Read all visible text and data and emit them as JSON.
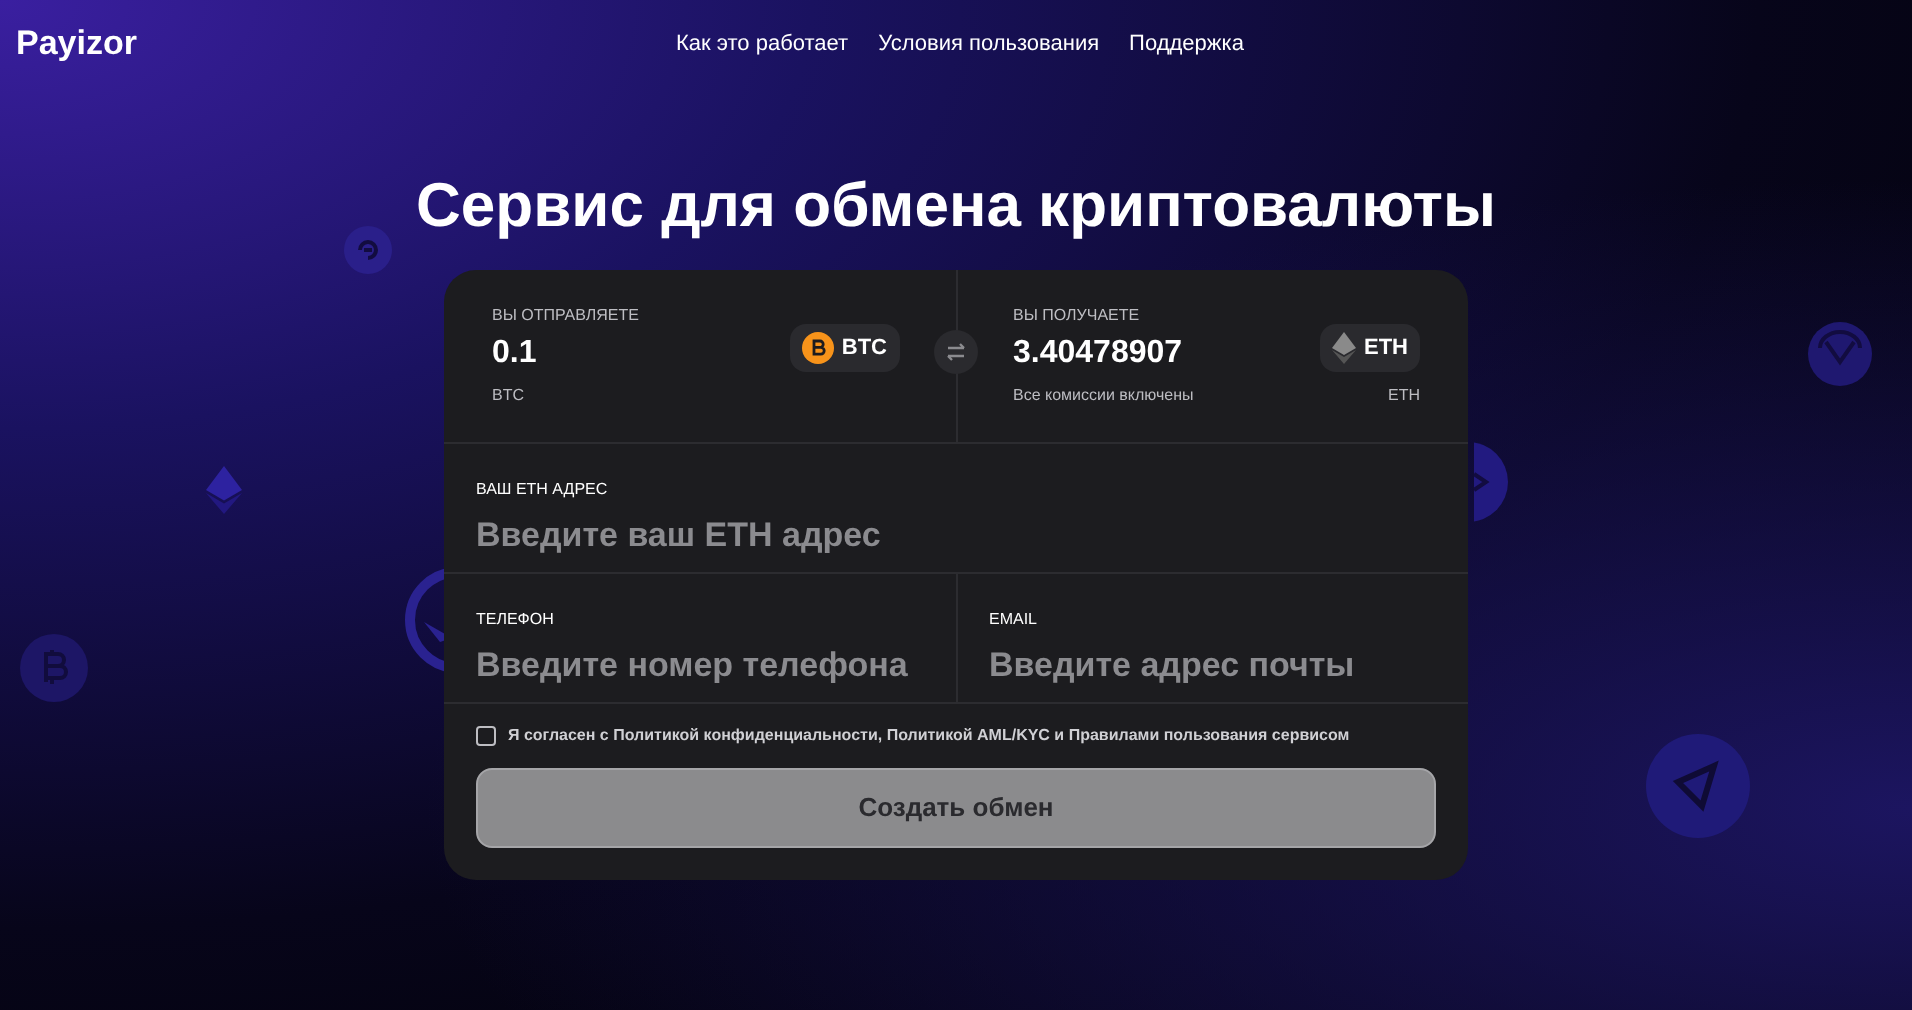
{
  "header": {
    "logo": "Payizor",
    "nav": [
      {
        "label": "Как это работает"
      },
      {
        "label": "Условия пользования"
      },
      {
        "label": "Поддержка"
      }
    ]
  },
  "title": "Сервис для обмена криптовалюты",
  "send": {
    "label": "ВЫ ОТПРАВЛЯЕТЕ",
    "amount": "0.1",
    "currency": "BTC",
    "note": "BTC",
    "kind": "btc"
  },
  "receive": {
    "label": "ВЫ ПОЛУЧАЕТЕ",
    "amount": "3.40478907",
    "currency": "ETH",
    "note": "Все комиссии включены",
    "note_right": "ETH",
    "kind": "eth"
  },
  "address": {
    "label": "ВАШ ETH АДРЕС",
    "placeholder": "Введите ваш ETH адрес"
  },
  "phone": {
    "label": "ТЕЛЕФОН",
    "placeholder": "Введите номер телефона"
  },
  "email": {
    "label": "EMAIL",
    "placeholder": "Введите адрес почты"
  },
  "agreement": {
    "text": "Я согласен с Политикой конфиденциальности, Политикой AML/KYC  и Правилами пользования сервисом",
    "checked": false
  },
  "submit": {
    "label": "Создать обмен",
    "disabled": true
  }
}
